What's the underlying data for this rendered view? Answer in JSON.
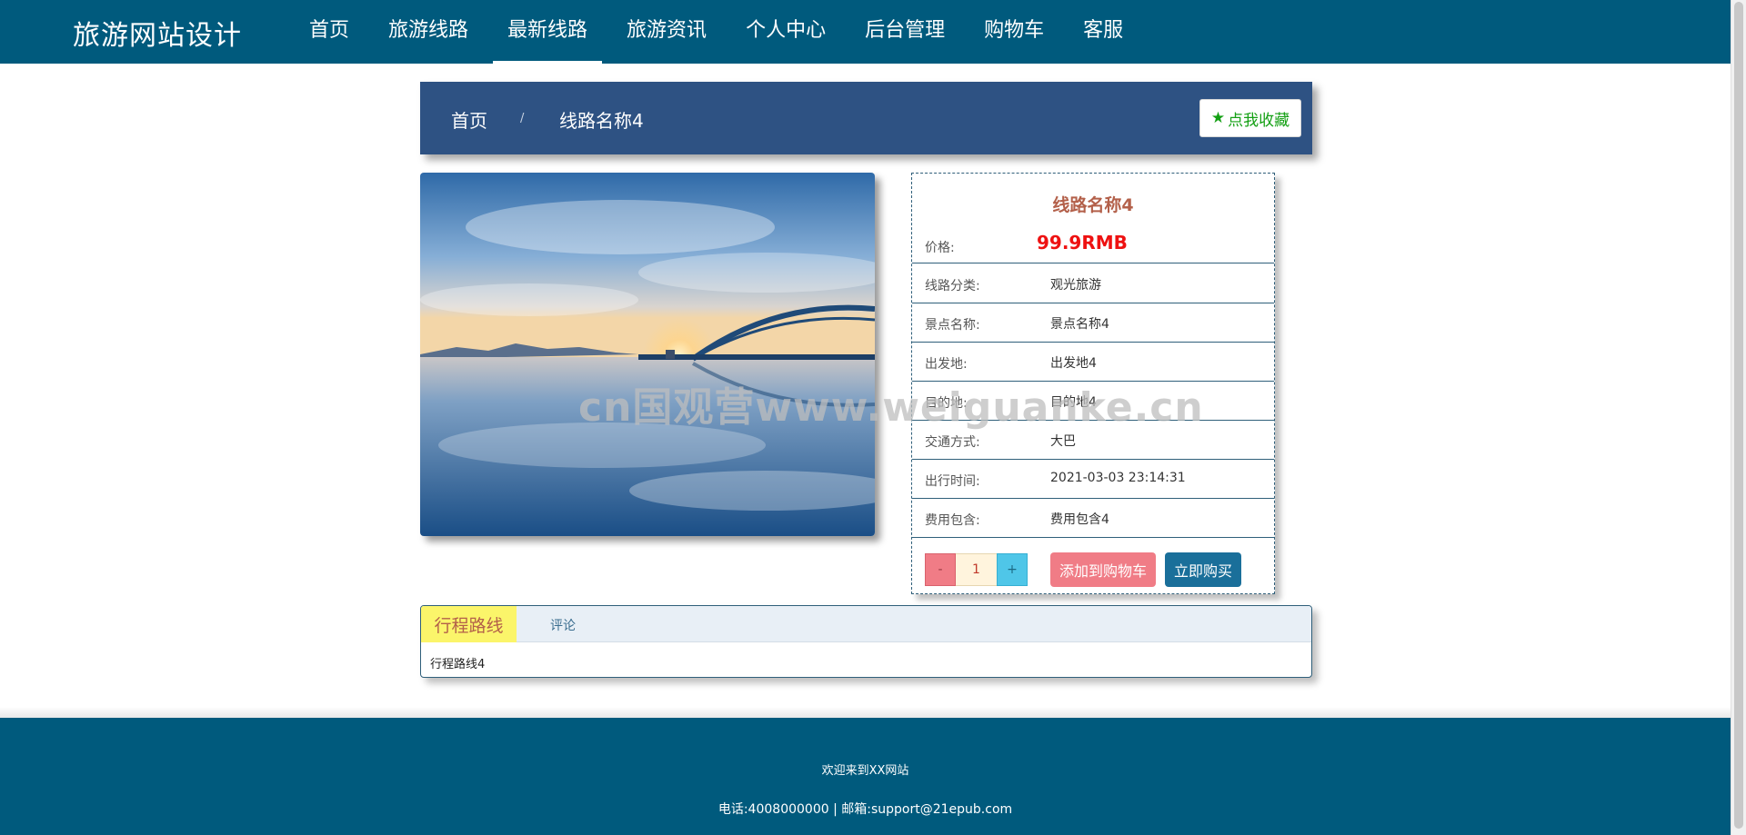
{
  "site": {
    "brand": "旅游网站设计"
  },
  "nav": {
    "items": [
      {
        "label": "首页"
      },
      {
        "label": "旅游线路"
      },
      {
        "label": "最新线路",
        "active": true
      },
      {
        "label": "旅游资讯"
      },
      {
        "label": "个人中心"
      },
      {
        "label": "后台管理"
      },
      {
        "label": "购物车"
      },
      {
        "label": "客服"
      }
    ]
  },
  "breadcrumb": {
    "home": "首页",
    "separator": "/",
    "current": "线路名称4",
    "favorite_label": "点我收藏"
  },
  "product": {
    "title": "线路名称4",
    "price_label": "价格:",
    "price_value": "99.9RMB",
    "fields": [
      {
        "label": "线路分类:",
        "value": "观光旅游"
      },
      {
        "label": "景点名称:",
        "value": "景点名称4"
      },
      {
        "label": "出发地:",
        "value": "出发地4"
      },
      {
        "label": "目的地:",
        "value": "目的地4"
      },
      {
        "label": "交通方式:",
        "value": "大巴"
      },
      {
        "label": "出行时间:",
        "value": "2021-03-03 23:14:31"
      },
      {
        "label": "费用包含:",
        "value": "费用包含4"
      }
    ],
    "quantity": "1",
    "minus_label": "-",
    "plus_label": "+",
    "add_to_cart_label": "添加到购物车",
    "buy_now_label": "立即购买"
  },
  "watermark": "cn国观营www.weiguanke.cn",
  "tabs": {
    "items": [
      {
        "label": "行程路线",
        "active": true
      },
      {
        "label": "评论"
      }
    ],
    "content": "行程路线4"
  },
  "footer": {
    "welcome": "欢迎来到XX网站",
    "contact": "电话:4008000000 | 邮箱:support@21epub.com"
  },
  "colors": {
    "header_bg": "#005a7d",
    "breadcrumb_bg": "#2e5283",
    "price": "#ee1111",
    "title": "#b3604a",
    "cart_button": "#f07c86",
    "buy_button": "#1a6f9a"
  }
}
